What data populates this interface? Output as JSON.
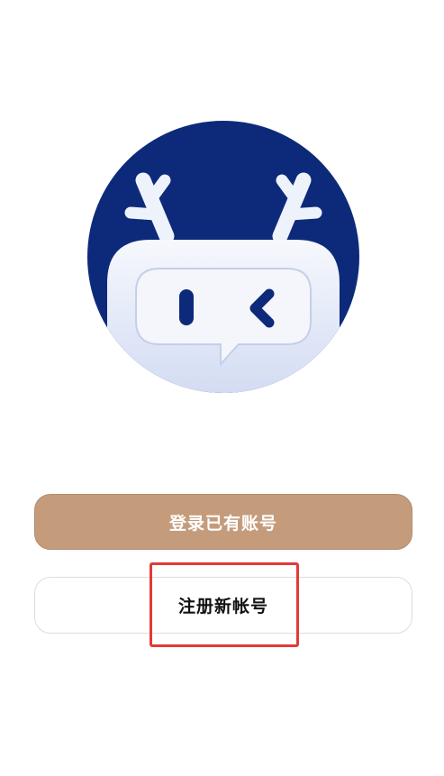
{
  "app": {
    "logo": {
      "icon": "reindeer-robot-chat-logo",
      "background_color": "#0d2a7a",
      "face_color": "#eef2fb"
    }
  },
  "actions": {
    "login_label": "登录已有账号",
    "register_label": "注册新帐号"
  },
  "highlight": {
    "target": "register-button",
    "color": "#e53935"
  }
}
